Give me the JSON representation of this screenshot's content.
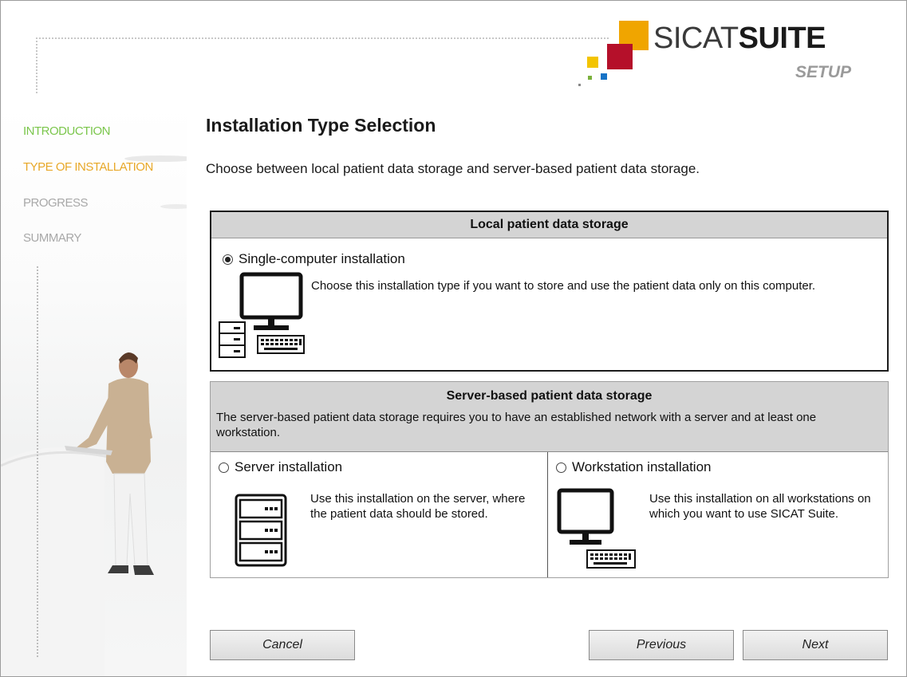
{
  "logo": {
    "brand_light": "SICAT",
    "brand_bold": "SUITE",
    "sub": "SETUP",
    "colors": {
      "orange": "#f0a500",
      "red": "#b5102a",
      "yellow": "#f3c400",
      "blue": "#1673c6",
      "green": "#7bb13c"
    }
  },
  "sidebar": {
    "items": [
      {
        "label": "INTRODUCTION",
        "state": "done",
        "color": "#7bc64c"
      },
      {
        "label": "TYPE OF INSTALLATION",
        "state": "current",
        "color": "#e8a828"
      },
      {
        "label": "PROGRESS",
        "state": "pending",
        "color": "#a8a8a8"
      },
      {
        "label": "SUMMARY",
        "state": "pending",
        "color": "#a8a8a8"
      }
    ]
  },
  "main": {
    "title": "Installation Type Selection",
    "subtitle": "Choose between local patient data storage and server-based patient data storage.",
    "local": {
      "header": "Local patient data storage",
      "option_label": "Single-computer installation",
      "option_checked": true,
      "description": "Choose this installation type if you want to store and use the patient data only on this computer.",
      "icon": "computer-with-server-icon"
    },
    "server_based": {
      "header": "Server-based patient data storage",
      "description": "The server-based patient data storage requires you to have an established network with a server and at least one workstation.",
      "server": {
        "option_label": "Server installation",
        "option_checked": false,
        "description": "Use this installation on the server, where the patient data should be stored.",
        "icon": "server-rack-icon"
      },
      "workstation": {
        "option_label": "Workstation installation",
        "option_checked": false,
        "description": "Use this installation on all workstations on which you want to use SICAT Suite.",
        "icon": "workstation-icon"
      }
    }
  },
  "buttons": {
    "cancel": "Cancel",
    "previous": "Previous",
    "next": "Next"
  }
}
